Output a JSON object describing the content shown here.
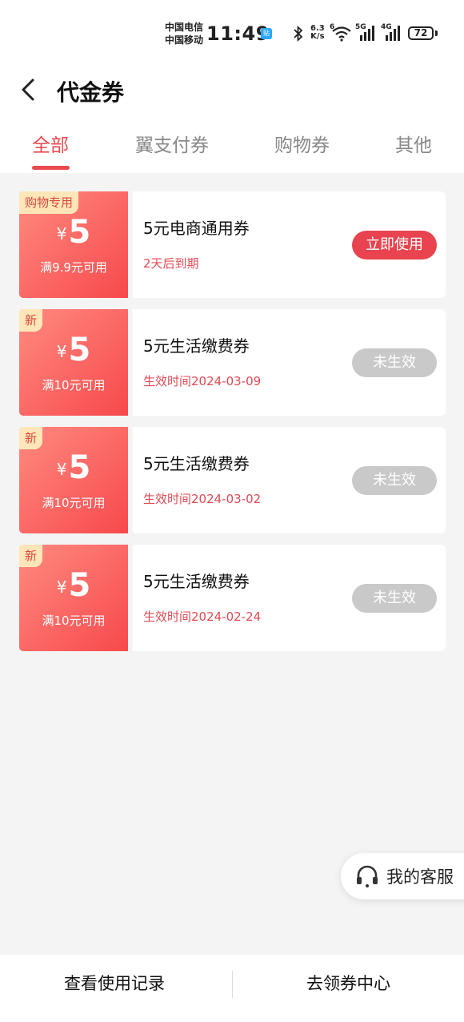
{
  "status_bar": {
    "carrier_1": "中国电信",
    "carrier_2": "中国移动",
    "time": "11:49",
    "app_badge": "贴",
    "net_speed_value": "6.3",
    "net_speed_unit": "K/s",
    "wifi_gen": "6",
    "signal_1_gen": "5G",
    "signal_2_gen": "4G",
    "battery": "72"
  },
  "header": {
    "title": "代金券",
    "back_icon": "chevron-left-icon"
  },
  "tabs": [
    {
      "label": "全部",
      "active": true
    },
    {
      "label": "翼支付券",
      "active": false
    },
    {
      "label": "购物券",
      "active": false
    },
    {
      "label": "其他",
      "active": false
    }
  ],
  "coupons": [
    {
      "tag": "购物专用",
      "currency": "¥",
      "amount": "5",
      "condition": "满9.9元可用",
      "name": "5元电商通用券",
      "subtitle": "2天后到期",
      "action": "立即使用"
    },
    {
      "tag": "新",
      "currency": "¥",
      "amount": "5",
      "condition": "满10元可用",
      "name": "5元生活缴费券",
      "subtitle": "生效时间2024-03-09",
      "action": "未生效"
    },
    {
      "tag": "新",
      "currency": "¥",
      "amount": "5",
      "condition": "满10元可用",
      "name": "5元生活缴费券",
      "subtitle": "生效时间2024-03-02",
      "action": "未生效"
    },
    {
      "tag": "新",
      "currency": "¥",
      "amount": "5",
      "condition": "满10元可用",
      "name": "5元生活缴费券",
      "subtitle": "生效时间2024-02-24",
      "action": "未生效"
    }
  ],
  "customer_service": {
    "label": "我的客服",
    "icon": "headset-icon"
  },
  "bottom_bar": {
    "history": "查看使用记录",
    "coupon_center": "去领券中心"
  },
  "colors": {
    "accent": "#e84a4f",
    "coupon_gradient_start": "#ff8a80",
    "coupon_gradient_end": "#f7494c",
    "tag_bg": "#ffe6b8",
    "inactive_button": "#c9c9c9",
    "background": "#f4f4f4"
  }
}
